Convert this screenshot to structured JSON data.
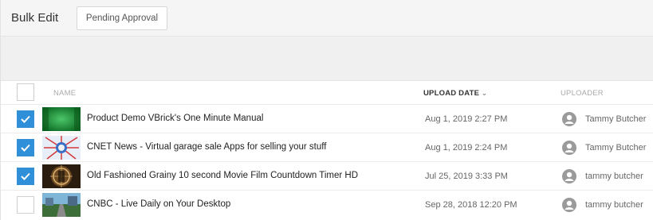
{
  "tabs": {
    "title": "Bulk Edit",
    "pending_label": "Pending Approval"
  },
  "table": {
    "columns": {
      "name": "NAME",
      "upload_date": "UPLOAD DATE",
      "uploader": "UPLOADER"
    },
    "sort_indicator": "⌄",
    "rows": [
      {
        "checked": true,
        "thumb": "green-screen-thumb",
        "title": "Product Demo VBrick's One Minute Manual",
        "date": "Aug 1, 2019 2:27 PM",
        "uploader": "Tammy Butcher"
      },
      {
        "checked": true,
        "thumb": "news-thumb",
        "title": "CNET News - Virtual garage sale Apps for selling your stuff",
        "date": "Aug 1, 2019 2:24 PM",
        "uploader": "Tammy Butcher"
      },
      {
        "checked": true,
        "thumb": "countdown-thumb",
        "title": "Old Fashioned Grainy 10 second Movie Film Countdown Timer HD",
        "date": "Jul 25, 2019 3:33 PM",
        "uploader": "tammy butcher"
      },
      {
        "checked": false,
        "thumb": "road-thumb",
        "title": "CNBC - Live Daily on Your Desktop",
        "date": "Sep 28, 2018 12:20 PM",
        "uploader": "tammy butcher"
      }
    ]
  },
  "colors": {
    "accent": "#2f8fd8",
    "header_bg": "#f5f5f5"
  }
}
